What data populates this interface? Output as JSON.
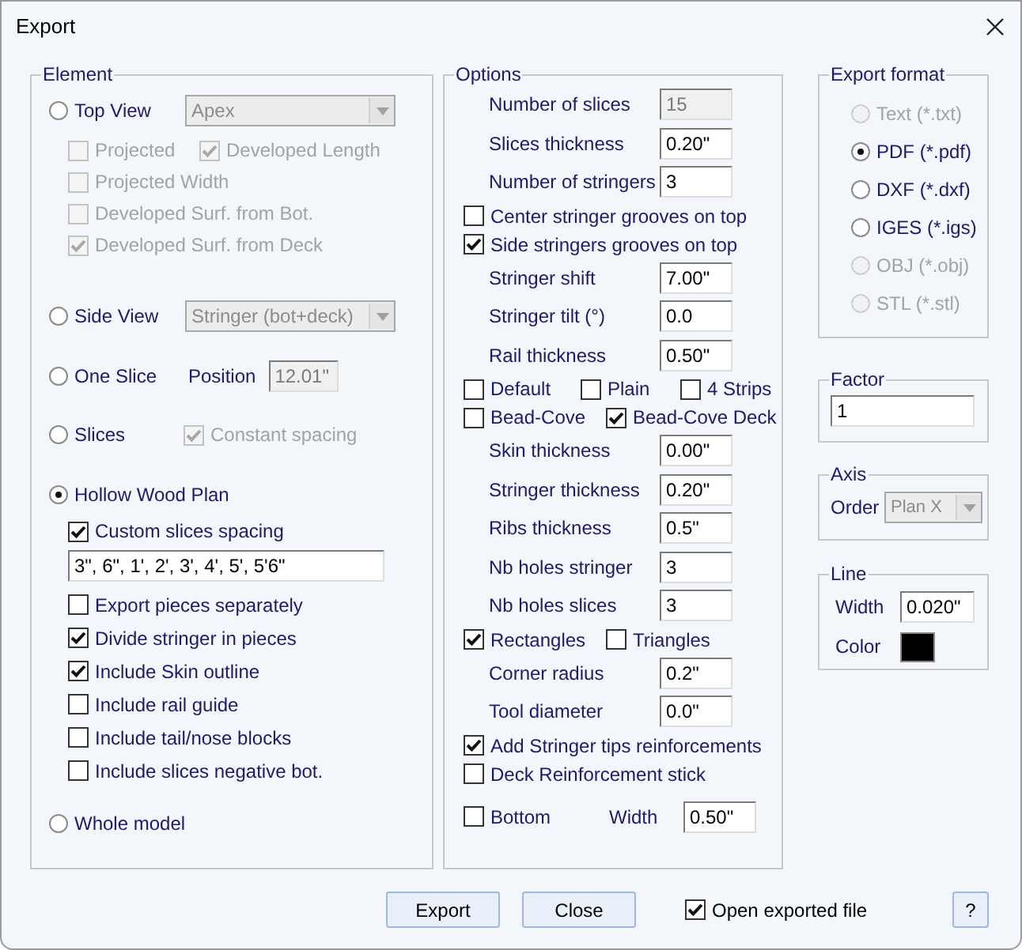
{
  "window": {
    "title": "Export"
  },
  "element": {
    "title": "Element",
    "top_view": {
      "label": "Top View",
      "selected": false,
      "dropdown": "Apex",
      "dropdown_disabled": true,
      "checks": [
        {
          "label": "Projected",
          "checked": false,
          "disabled": true
        },
        {
          "label": "Developed Length",
          "checked": true,
          "disabled": true
        },
        {
          "label": "Projected Width",
          "checked": false,
          "disabled": true
        },
        {
          "label": "Developed Surf. from Bot.",
          "checked": false,
          "disabled": true
        },
        {
          "label": "Developed Surf. from Deck",
          "checked": true,
          "disabled": true
        }
      ]
    },
    "side_view": {
      "label": "Side View",
      "selected": false,
      "dropdown": "Stringer (bot+deck)",
      "dropdown_disabled": true
    },
    "one_slice": {
      "label": "One Slice",
      "selected": false,
      "position_label": "Position",
      "position": "12.01\"",
      "position_disabled": true
    },
    "slices": {
      "label": "Slices",
      "selected": false,
      "constant_spacing": {
        "label": "Constant spacing",
        "checked": true,
        "disabled": true
      }
    },
    "hollow": {
      "label": "Hollow Wood Plan",
      "selected": true,
      "custom": {
        "label": "Custom slices spacing",
        "checked": true
      },
      "spacing": "3\", 6\", 1', 2', 3', 4', 5', 5'6\"",
      "checks": [
        {
          "label": "Export pieces separately",
          "checked": false
        },
        {
          "label": "Divide stringer in pieces",
          "checked": true
        },
        {
          "label": "Include Skin outline",
          "checked": true
        },
        {
          "label": "Include rail guide",
          "checked": false
        },
        {
          "label": "Include tail/nose blocks",
          "checked": false
        },
        {
          "label": "Include slices negative bot.",
          "checked": false
        }
      ]
    },
    "whole": {
      "label": "Whole model",
      "selected": false
    }
  },
  "options": {
    "title": "Options",
    "rows": [
      {
        "kind": "field",
        "label": "Number of slices",
        "value": "15",
        "disabled": true
      },
      {
        "kind": "field",
        "label": "Slices thickness",
        "value": "0.20\"",
        "disabled": false
      },
      {
        "kind": "field",
        "label": "Number of stringers",
        "value": "3",
        "disabled": false
      },
      {
        "kind": "checks",
        "items": [
          {
            "label": "Center stringer grooves on top",
            "checked": false
          }
        ]
      },
      {
        "kind": "checks",
        "items": [
          {
            "label": "Side stringers grooves on top",
            "checked": true
          }
        ]
      },
      {
        "kind": "field",
        "label": "Stringer shift",
        "value": "7.00\"",
        "disabled": false
      },
      {
        "kind": "field",
        "label": "Stringer tilt (°)",
        "value": "0.0",
        "disabled": false
      },
      {
        "kind": "field",
        "label": "Rail thickness",
        "value": "0.50\"",
        "disabled": false
      },
      {
        "kind": "checks",
        "items": [
          {
            "label": "Default",
            "checked": false
          },
          {
            "label": "Plain",
            "checked": false
          },
          {
            "label": "4 Strips",
            "checked": false
          }
        ]
      },
      {
        "kind": "checks",
        "items": [
          {
            "label": "Bead-Cove",
            "checked": false
          },
          {
            "label": "Bead-Cove Deck",
            "checked": true
          }
        ]
      },
      {
        "kind": "field",
        "label": "Skin thickness",
        "value": "0.00\"",
        "disabled": false
      },
      {
        "kind": "field",
        "label": "Stringer thickness",
        "value": "0.20\"",
        "disabled": false
      },
      {
        "kind": "field",
        "label": "Ribs thickness",
        "value": "0.5\"",
        "disabled": false
      },
      {
        "kind": "field",
        "label": "Nb holes stringer",
        "value": "3",
        "disabled": false
      },
      {
        "kind": "field",
        "label": "Nb holes slices",
        "value": "3",
        "disabled": false
      },
      {
        "kind": "checks",
        "items": [
          {
            "label": "Rectangles",
            "checked": true
          },
          {
            "label": "Triangles",
            "checked": false
          }
        ]
      },
      {
        "kind": "field",
        "label": "Corner radius",
        "value": "0.2\"",
        "disabled": false
      },
      {
        "kind": "field",
        "label": "Tool diameter",
        "value": "0.0\"",
        "disabled": false
      },
      {
        "kind": "checks",
        "items": [
          {
            "label": "Add Stringer tips reinforcements",
            "checked": true
          }
        ]
      },
      {
        "kind": "checks",
        "items": [
          {
            "label": "Deck Reinforcement stick",
            "checked": false
          }
        ]
      },
      {
        "kind": "check_field",
        "check": {
          "label": "Bottom",
          "checked": false
        },
        "label": "Width",
        "value": "0.50\"",
        "disabled": false
      }
    ]
  },
  "export_format": {
    "title": "Export format",
    "formats": [
      {
        "label": "Text (*.txt)",
        "selected": false,
        "disabled": true
      },
      {
        "label": "PDF (*.pdf)",
        "selected": true,
        "disabled": false
      },
      {
        "label": "DXF (*.dxf)",
        "selected": false,
        "disabled": false
      },
      {
        "label": "IGES (*.igs)",
        "selected": false,
        "disabled": false
      },
      {
        "label": "OBJ (*.obj)",
        "selected": false,
        "disabled": true
      },
      {
        "label": "STL (*.stl)",
        "selected": false,
        "disabled": true
      }
    ]
  },
  "factor": {
    "title": "Factor",
    "value": "1"
  },
  "axis": {
    "title": "Axis",
    "label": "Order",
    "dropdown": "Plan X",
    "disabled": true
  },
  "line": {
    "title": "Line",
    "width_label": "Width",
    "width": "0.020\"",
    "color_label": "Color",
    "color": "#000000"
  },
  "buttons": [
    "Export",
    "Close"
  ],
  "open_exported": {
    "label": "Open exported file",
    "checked": true
  },
  "help": "?"
}
